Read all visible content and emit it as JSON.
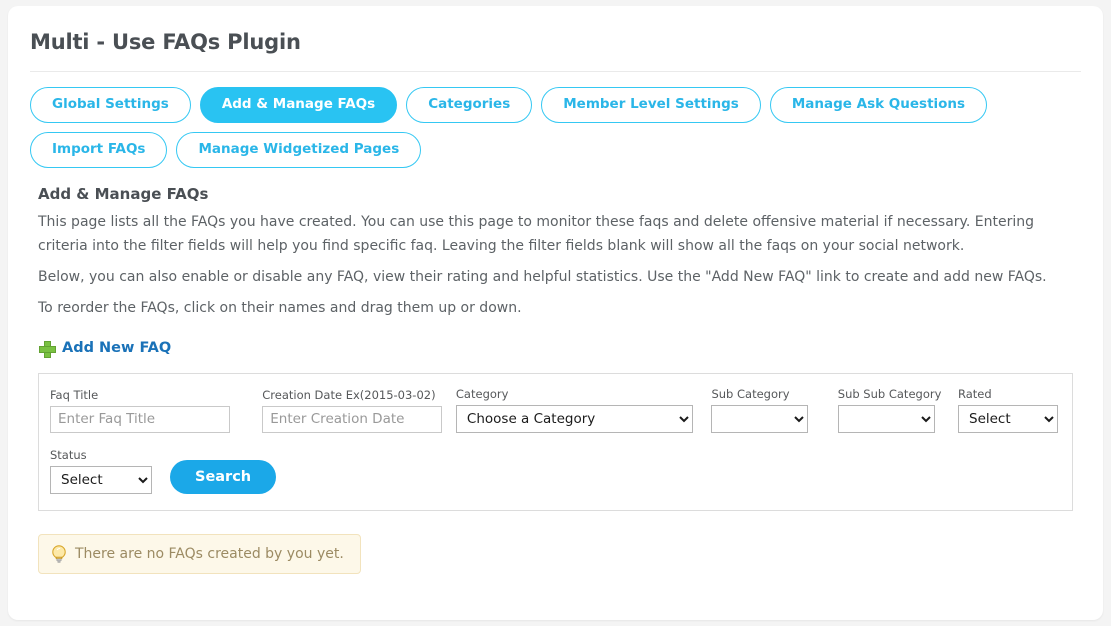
{
  "page": {
    "title": "Multi - Use FAQs Plugin"
  },
  "tabs": [
    {
      "label": "Global Settings",
      "active": false
    },
    {
      "label": "Add & Manage FAQs",
      "active": true
    },
    {
      "label": "Categories",
      "active": false
    },
    {
      "label": "Member Level Settings",
      "active": false
    },
    {
      "label": "Manage Ask Questions",
      "active": false
    },
    {
      "label": "Import FAQs",
      "active": false
    },
    {
      "label": "Manage Widgetized Pages",
      "active": false
    }
  ],
  "section": {
    "heading": "Add & Manage FAQs",
    "paragraphs": [
      "This page lists all the FAQs you have created. You can use this page to monitor these faqs and delete offensive material if necessary. Entering criteria into the filter fields will help you find specific faq. Leaving the filter fields blank will show all the faqs on your social network.",
      "Below, you can also enable or disable any FAQ, view their rating and helpful statistics. Use the \"Add New FAQ\" link to create and add new FAQs.",
      "To reorder the FAQs, click on their names and drag them up or down."
    ]
  },
  "add_new": {
    "label": "Add New FAQ",
    "icon": "plus-icon"
  },
  "filters": {
    "faq_title": {
      "label": "Faq Title",
      "placeholder": "Enter Faq Title",
      "value": ""
    },
    "creation_date": {
      "label": "Creation Date Ex(2015-03-02)",
      "placeholder": "Enter Creation Date",
      "value": ""
    },
    "category": {
      "label": "Category",
      "selected": "Choose a Category",
      "options": [
        "Choose a Category"
      ]
    },
    "sub_category": {
      "label": "Sub Category",
      "selected": "",
      "options": [
        ""
      ]
    },
    "sub_sub_category": {
      "label": "Sub Sub Category",
      "selected": "",
      "options": [
        ""
      ]
    },
    "rated": {
      "label": "Rated",
      "selected": "Select",
      "options": [
        "Select"
      ]
    },
    "status": {
      "label": "Status",
      "selected": "Select",
      "options": [
        "Select"
      ]
    },
    "search_button": "Search"
  },
  "notice": {
    "icon": "lightbulb-icon",
    "text": "There are no FAQs created by you yet."
  },
  "colors": {
    "accent_cyan": "#29c3f2",
    "tab_border": "#35c8f3",
    "search_blue": "#1ba8e8",
    "link_blue": "#1a72b8",
    "plus_green": "#7ac142",
    "notice_bg": "#fdf8e9",
    "notice_border": "#f2e3bd",
    "notice_text": "#9c8b63",
    "page_bg": "#f4f4f4"
  }
}
